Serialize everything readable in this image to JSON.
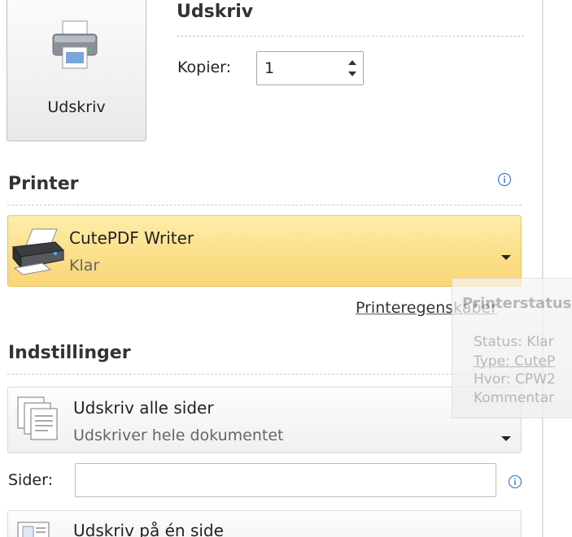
{
  "print": {
    "heading": "Udskriv",
    "button_label": "Udskriv",
    "copies_label": "Kopier:",
    "copies_value": "1"
  },
  "printer": {
    "heading": "Printer",
    "name": "CutePDF Writer",
    "status": "Klar",
    "properties_link": "Printeregenskaber",
    "tooltip": {
      "title": "Printerstatus",
      "status": "Status: Klar",
      "type": "Type: CuteP",
      "where": "Hvor: CPW2",
      "comment": "Kommentar"
    }
  },
  "settings": {
    "heading": "Indstillinger",
    "print_all": {
      "name": "Udskriv alle sider",
      "desc": "Udskriver hele dokumentet"
    },
    "pages_label": "Sider:",
    "pages_value": "",
    "one_side": {
      "name": "Udskriv på én side"
    }
  },
  "colors": {
    "accent_yellow": "#fbe08d",
    "info_blue": "#3f7fcf"
  }
}
